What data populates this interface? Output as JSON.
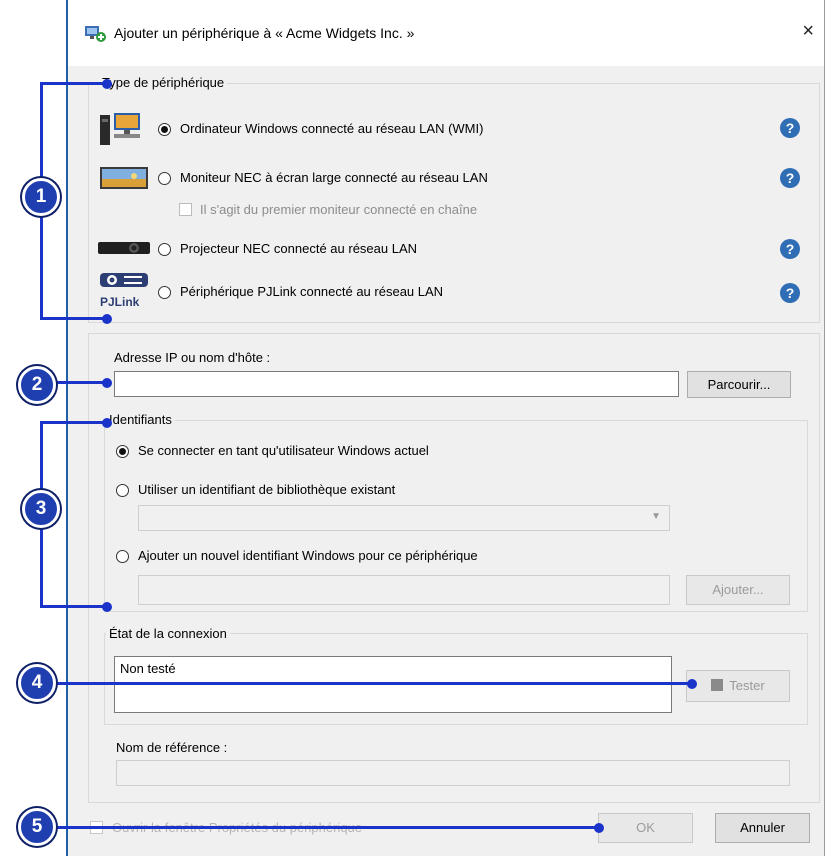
{
  "dialog": {
    "title": "Ajouter un périphérique à « Acme Widgets Inc. »",
    "close_glyph": "×"
  },
  "device_type": {
    "group_label": "Type de périphérique",
    "options": [
      {
        "label": "Ordinateur Windows connecté au réseau LAN (WMI)",
        "checked": true,
        "icon": "windows-computer-icon"
      },
      {
        "label": "Moniteur NEC à écran large connecté au réseau LAN",
        "checked": false,
        "icon": "nec-monitor-icon"
      },
      {
        "label": "Projecteur NEC connecté au réseau LAN",
        "checked": false,
        "icon": "projector-icon"
      },
      {
        "label": "Périphérique PJLink connecté au réseau LAN",
        "checked": false,
        "icon": "pjlink-icon"
      }
    ],
    "daisy_chain_label": "Il s'agit du premier moniteur connecté en chaîne",
    "help_glyph": "?",
    "pjlink_text": "PJLink"
  },
  "address": {
    "label": "Adresse IP ou nom d'hôte :",
    "value": "",
    "browse_label": "Parcourir..."
  },
  "credentials": {
    "group_label": "Identifiants",
    "opt_current": "Se connecter en tant qu'utilisateur Windows actuel",
    "opt_library": "Utiliser un identifiant de bibliothèque existant",
    "opt_new": "Ajouter un nouvel identifiant Windows pour ce périphérique",
    "add_label": "Ajouter..."
  },
  "connection": {
    "group_label": "État de la connexion",
    "status": "Non testé",
    "test_label": "Tester"
  },
  "reference": {
    "label": "Nom de référence :"
  },
  "footer": {
    "open_props_label": "Ouvrir la fenêtre Propriétés du périphérique",
    "ok_label": "OK",
    "cancel_label": "Annuler"
  },
  "callouts": [
    "1",
    "2",
    "3",
    "4",
    "5"
  ],
  "colors": {
    "accent": "#1a33c8",
    "marker": "#1f3fb0",
    "help": "#2f6db5"
  }
}
